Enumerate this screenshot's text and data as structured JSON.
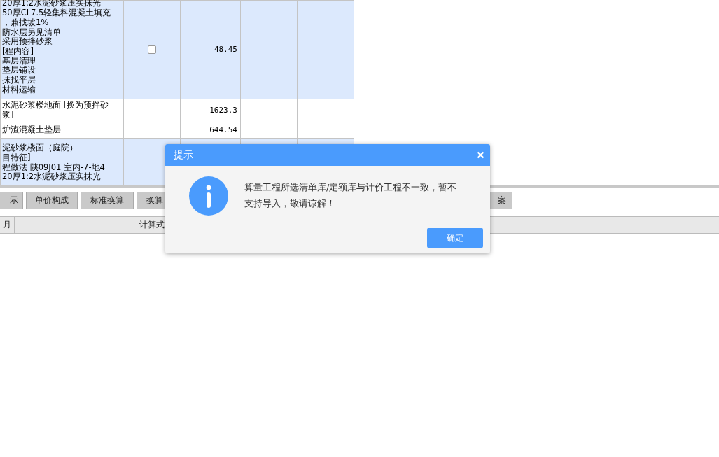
{
  "table": {
    "rows": [
      {
        "highlighted": true,
        "lines": [
          "20厚1:2水泥砂浆压实抹光",
          "50厚CL7.5轻集料混凝土填充",
          "，兼找坡1%",
          "防水层另见清单",
          "采用预拌砂浆",
          "[程内容]",
          "基层清理",
          "垫层铺设",
          "抹找平层",
          "材料运输"
        ],
        "checkbox": {
          "checked": false
        },
        "amount": "48.45"
      },
      {
        "highlighted": false,
        "lines": [
          "水泥砂浆楼地面 [换为预拌砂",
          "浆]"
        ],
        "amount": "1623.3"
      },
      {
        "highlighted": false,
        "lines": [
          "炉渣混凝土垫层"
        ],
        "amount": "644.54"
      },
      {
        "highlighted": true,
        "lines": [
          "泥砂浆楼面（庭院）",
          "目特征]",
          "程做法 陕09J01 室内-7-地4",
          "20厚1:2水泥砂浆压实抹光"
        ]
      }
    ]
  },
  "tabs": [
    {
      "label": "示",
      "selected": false
    },
    {
      "label": "单价构成",
      "selected": false
    },
    {
      "label": "标准换算",
      "selected": false
    },
    {
      "label": "换算",
      "selected": false
    },
    {
      "label": "案",
      "selected": false
    }
  ],
  "subtable": {
    "columns": [
      "月",
      "计算式"
    ]
  },
  "dialog": {
    "title": "提示",
    "message": "算量工程所选清单库/定额库与计价工程不一致，暂不支持导入，敬请谅解！",
    "button": "确定"
  }
}
